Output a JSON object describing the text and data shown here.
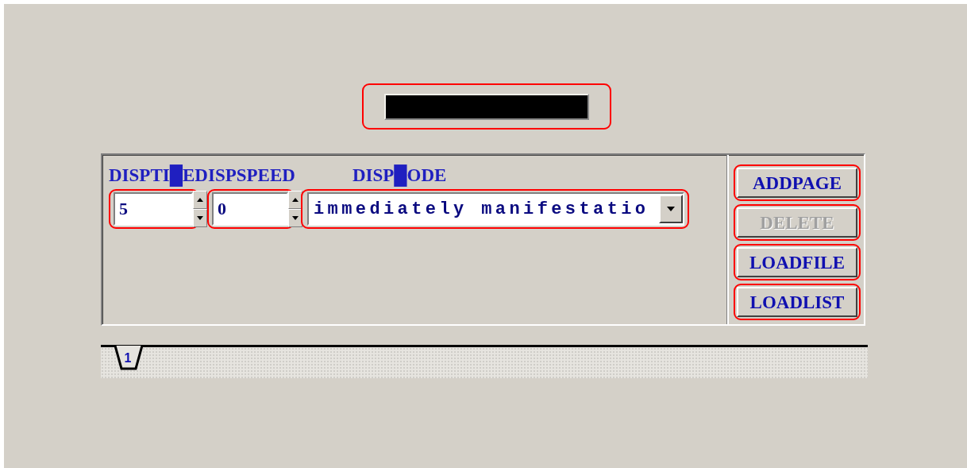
{
  "labels": [
    "DISPTI█E",
    "DISPSPEED",
    "DISP█ODE"
  ],
  "disp_time": {
    "value": "5"
  },
  "disp_speed": {
    "value": "0"
  },
  "disp_mode": {
    "value": "immediately manifestatio"
  },
  "buttons": [
    {
      "label": "ADDPAGE",
      "disabled": false
    },
    {
      "label": "DELETE",
      "disabled": true
    },
    {
      "label": "LOADFILE",
      "disabled": false
    },
    {
      "label": "LOADLIST",
      "disabled": false
    }
  ],
  "tabs": [
    {
      "label": "1",
      "selected": true
    }
  ]
}
